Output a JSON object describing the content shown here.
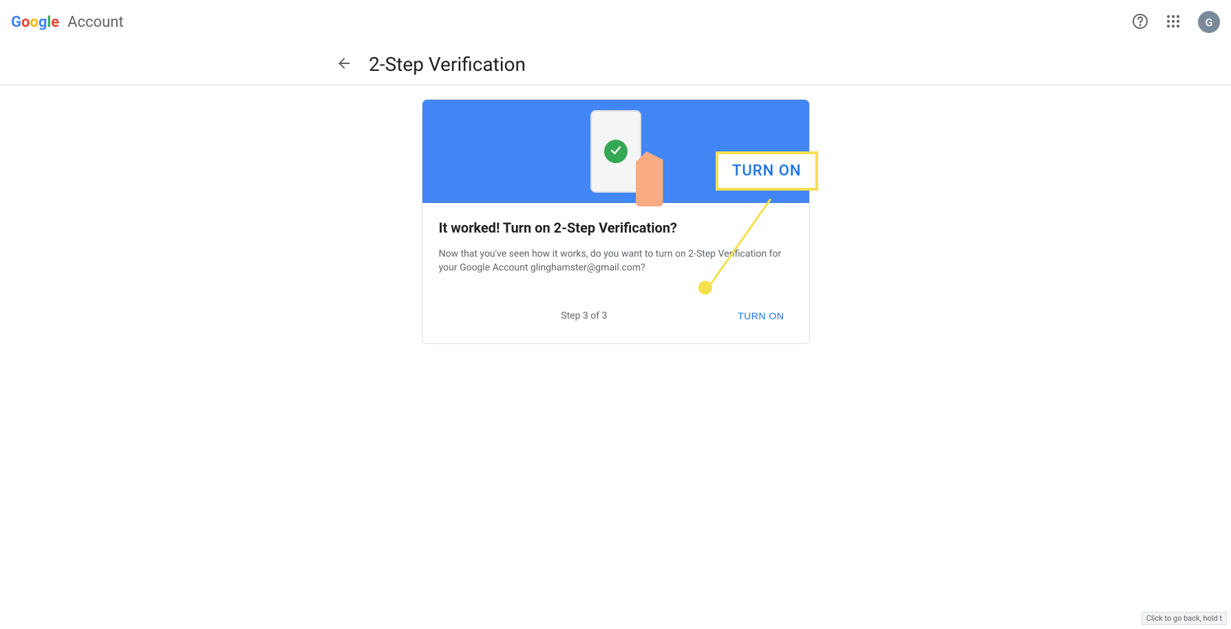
{
  "header": {
    "logo_account_label": "Account",
    "avatar_initial": "G"
  },
  "title_row": {
    "page_title": "2-Step Verification"
  },
  "card": {
    "title": "It worked! Turn on 2-Step Verification?",
    "desc_before_email": "Now that you've seen how it works, do you want to turn on 2-Step Verification for your Google Account ",
    "email": "glinghamster@gmail.com?",
    "step_counter": "Step 3 of 3",
    "turn_on_label": "TURN ON"
  },
  "callout": {
    "label": "TURN ON"
  },
  "tooltip": {
    "text": "Click to go back, hold t"
  },
  "icons": {
    "help": "help-icon",
    "apps": "apps-icon",
    "back": "arrow-back-icon",
    "check": "check-icon"
  },
  "colors": {
    "blue": "#4285f4",
    "green": "#34a853",
    "highlight": "#f4e04d",
    "link": "#1a73e8"
  }
}
